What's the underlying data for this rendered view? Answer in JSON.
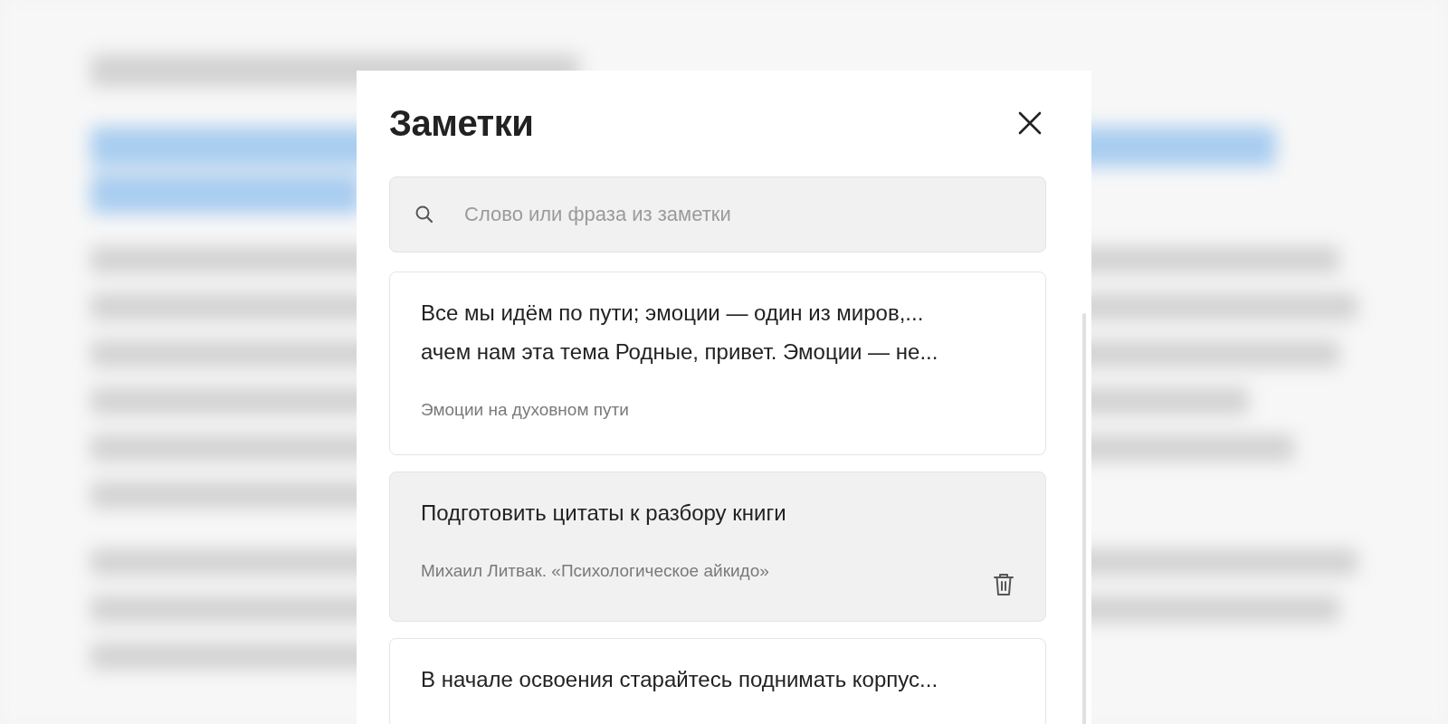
{
  "modal": {
    "title": "Заметки",
    "search": {
      "placeholder": "Слово или фраза из заметки"
    },
    "notes": [
      {
        "lines": [
          "Все мы идём по пути; эмоции — один из миров,...",
          "ачем нам эта тема Родные, привет. Эмоции — не..."
        ],
        "source": "Эмоции на духовном пути",
        "hovered": false
      },
      {
        "lines": [
          "Подготовить цитаты к разбору книги"
        ],
        "source": "Михаил Литвак. «Психологическое айкидо»",
        "hovered": true
      },
      {
        "lines": [
          "В начале освоения старайтесь поднимать корпус..."
        ],
        "hovered": false
      }
    ]
  }
}
